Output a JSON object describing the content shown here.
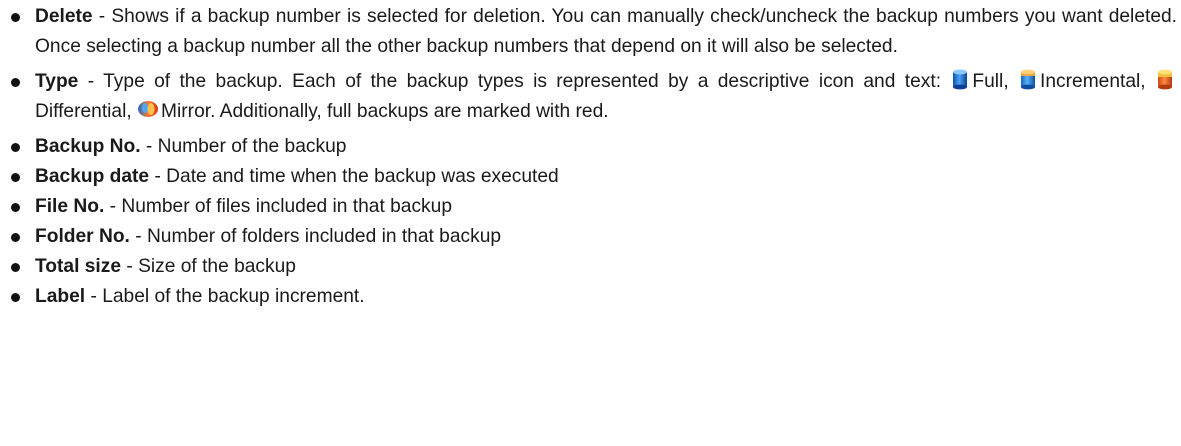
{
  "items": [
    {
      "term": "Delete",
      "sep": " - ",
      "desc": "Shows if a backup number is selected for deletion. You can manually check/uncheck the backup numbers you want deleted. Once selecting a backup number all the other backup numbers that depend on it will also be selected."
    },
    {
      "term": "Type",
      "sep": " - ",
      "desc_before": "Type of the backup. Each of the backup types is represented by a descriptive icon and text: ",
      "types": [
        {
          "label": "Full",
          "icon": "full-backup-icon",
          "color": "#1f6fd1"
        },
        {
          "label": "Incremental",
          "icon": "incremental-backup-icon",
          "color": "#2a86d8"
        },
        {
          "label": "Differential",
          "icon": "differential-backup-icon",
          "color": "#e8742a"
        },
        {
          "label": "Mirror",
          "icon": "mirror-backup-icon",
          "color": "#e65a1e"
        }
      ],
      "type_separator": ", ",
      "desc_after": ". Additionally, full backups are marked with red."
    },
    {
      "term": "Backup No.",
      "sep": " - ",
      "desc": "Number of the backup"
    },
    {
      "term": "Backup date",
      "sep": " - ",
      "desc": "Date and time when the backup was executed"
    },
    {
      "term": "File No.",
      "sep": " - ",
      "desc": "Number of files included in that backup"
    },
    {
      "term": "Folder No.",
      "sep": " - ",
      "desc": "Number of folders included in that backup"
    },
    {
      "term": "Total size",
      "sep": " - ",
      "desc": "Size of the backup"
    },
    {
      "term": "Label",
      "sep": " - ",
      "desc": "Label of the backup increment."
    }
  ]
}
